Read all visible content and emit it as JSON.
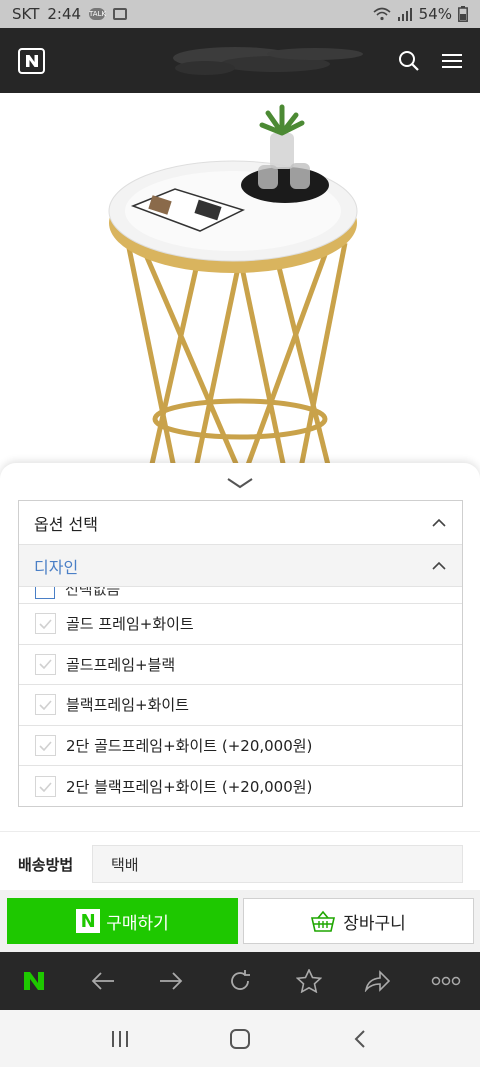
{
  "status_bar": {
    "carrier": "SKT",
    "time": "2:44",
    "battery": "54%"
  },
  "app_header": {
    "logo_letter": "N",
    "icons": [
      "search-icon",
      "menu-icon"
    ]
  },
  "option_panel": {
    "title": "옵션 선택",
    "design_label": "디자인",
    "partial_item": "선택없음",
    "options": [
      "골드 프레임+화이트",
      "골드프레임+블랙",
      "블랙프레임+화이트",
      "2단 골드프레임+화이트 (+20,000원)",
      "2단 블랙프레임+화이트 (+20,000원)"
    ]
  },
  "shipping": {
    "label": "배송방법",
    "value": "택배"
  },
  "actions": {
    "buy_icon_letter": "N",
    "buy_label": "구매하기",
    "cart_label": "장바구니"
  },
  "browser_nav": {
    "logo_letter": "N",
    "icons": [
      "back-arrow-icon",
      "forward-arrow-icon",
      "refresh-icon",
      "star-icon",
      "share-icon",
      "more-icon"
    ]
  },
  "colors": {
    "accent_green": "#1ec800",
    "header_dark": "#262626",
    "link_blue": "#4a7fc6"
  }
}
